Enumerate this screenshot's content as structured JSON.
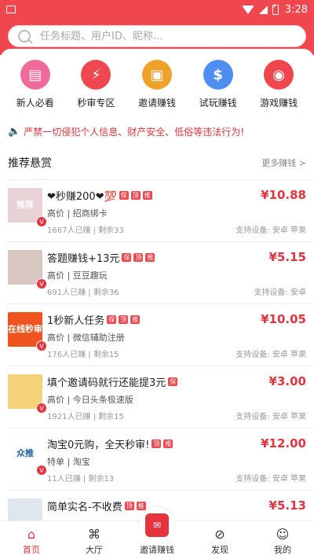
{
  "statusbar": {
    "time": "3:28"
  },
  "search": {
    "placeholder": "任务标题、用户ID、昵称..."
  },
  "quick_links": [
    {
      "label": "新人必看",
      "icon": "book-icon",
      "color": "#f06a9a",
      "glyph": "▤"
    },
    {
      "label": "秒审专区",
      "icon": "lightning-icon",
      "color": "#f0474f",
      "glyph": "⚡"
    },
    {
      "label": "邀请赚钱",
      "icon": "gift-icon",
      "color": "#f0a12a",
      "glyph": "▣"
    },
    {
      "label": "试玩赚钱",
      "icon": "moneybag-icon",
      "color": "#4d8ef0",
      "glyph": "$"
    },
    {
      "label": "游戏赚钱",
      "icon": "gamepad-icon",
      "color": "#f0474f",
      "glyph": "◉"
    }
  ],
  "notice": {
    "text": "严禁一切侵犯个人信息、财产安全、低俗等违法行为!"
  },
  "section": {
    "title": "推荐悬赏",
    "more": "更多赚钱 >"
  },
  "tasks": [
    {
      "title": "❤秒赚200❤💯",
      "tags": [
        "保",
        "顶",
        "推"
      ],
      "meta": "高价 | 招商绑卡",
      "stats": "1667人已赚 | 剩余33",
      "price": "¥10.88",
      "devices": "支持设备: 安卓 苹果",
      "thumb_text": "推荐",
      "thumb_color": "#e9d2d6"
    },
    {
      "title": "答题赚钱+13元",
      "tags": [
        "保",
        "顶",
        "推"
      ],
      "meta": "高价 | 豆豆趣玩",
      "stats": "691人已赚 | 剩余36",
      "price": "¥5.15",
      "devices": "支持设备: 安卓",
      "thumb_text": "",
      "thumb_color": "#d8c6c0"
    },
    {
      "title": "1秒新人任务",
      "tags": [
        "保",
        "顶",
        "推"
      ],
      "meta": "高价 | 微信辅助注册",
      "stats": "176人已赚 | 剩余15",
      "price": "¥10.05",
      "devices": "支持设备: 安卓 苹果",
      "thumb_text": "在线秒审",
      "thumb_color": "#f0541e"
    },
    {
      "title": "填个邀请码就行还能提3元",
      "tags": [
        "保"
      ],
      "meta": "高价 | 今日头条极速版",
      "stats": "1921人已赚 | 剩余15",
      "price": "¥3.00",
      "devices": "支持设备: 安卓 苹果",
      "thumb_text": "",
      "thumb_color": "#f5d27a"
    },
    {
      "title": "淘宝0元购，全天秒审!",
      "tags": [
        "顶",
        "推"
      ],
      "meta": "特单 | 淘宝",
      "stats": "11人已赚 | 剩余13",
      "price": "¥12.00",
      "devices": "支持设备: 安卓 苹果",
      "thumb_text": "众推",
      "thumb_color": "#ffffff"
    },
    {
      "title": "简单实名-不收费",
      "tags": [
        "顶",
        "推"
      ],
      "meta": "",
      "stats": "",
      "price": "¥5.13",
      "devices": "",
      "thumb_text": "",
      "thumb_color": "#dfe6ee"
    }
  ],
  "tabbar": [
    {
      "label": "首页",
      "icon": "home-icon",
      "active": true
    },
    {
      "label": "大厅",
      "icon": "grid-icon",
      "active": false
    },
    {
      "label": "邀请赚钱",
      "icon": "invite-envelope-icon",
      "active": false
    },
    {
      "label": "发现",
      "icon": "compass-icon",
      "active": false
    },
    {
      "label": "我的",
      "icon": "user-icon",
      "active": false
    }
  ],
  "colors": {
    "brand": "#f0474f",
    "price": "#e6343e"
  }
}
